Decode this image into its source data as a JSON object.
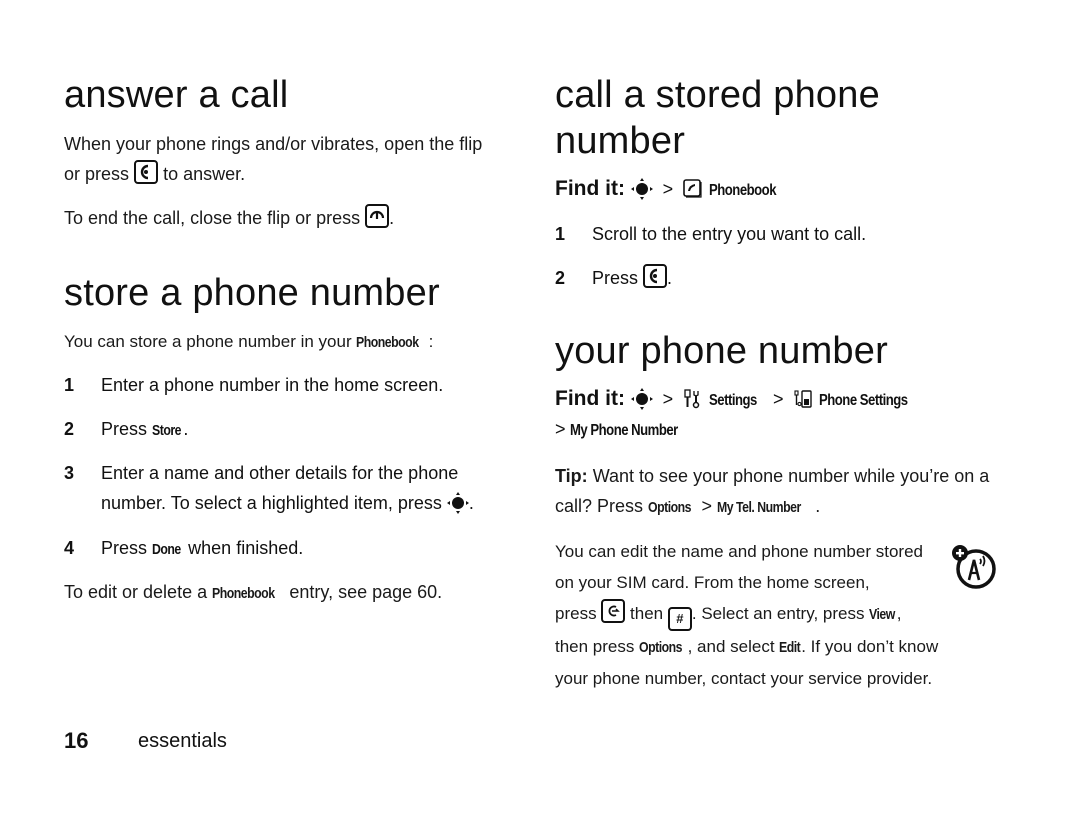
{
  "left": {
    "answer": {
      "title": "answer a call",
      "p1_a": "When your phone rings and/or vibrates, open the flip",
      "p1_b": "or press",
      "p1_c": "to answer.",
      "p2_a": "To end the call, close the flip or press",
      "p2_b": "."
    },
    "store": {
      "title": "store a phone number",
      "intro_a": "You can store a phone number in your",
      "intro_term": "Phonebook",
      "intro_b": ":",
      "steps": [
        {
          "num": "1",
          "text": "Enter a phone number in the home screen."
        },
        {
          "num": "2",
          "text_a": "Press",
          "term": "Store",
          "text_b": "."
        },
        {
          "num": "3",
          "text_a": "Enter a name and other details for the phone",
          "text_b": "number. To select a highlighted item, press",
          "text_c": "."
        },
        {
          "num": "4",
          "text_a": "Press",
          "term": "Done",
          "text_b": "when finished."
        }
      ],
      "outro_a": "To edit or delete a",
      "outro_term": "Phonebook",
      "outro_b": "entry, see page 60."
    }
  },
  "right": {
    "call_stored": {
      "title_line1": "call a stored phone",
      "title_line2": "number",
      "findit_label": "Find it:",
      "path": [
        ">",
        "Phonebook"
      ],
      "steps": [
        {
          "num": "1",
          "text": "Scroll to the entry you want to call."
        },
        {
          "num": "2",
          "text_a": "Press",
          "text_b": "."
        }
      ]
    },
    "your_number": {
      "title": "your phone number",
      "findit_label": "Find it:",
      "path": [
        ">",
        "Settings",
        ">",
        "Phone Settings",
        ">",
        "My Phone Number"
      ],
      "tip_label": "Tip:",
      "tip_a": "Want to see your phone number while you’re on a",
      "tip_b": "call? Press",
      "tip_term1": "Options",
      "tip_gt": ">",
      "tip_term2": "My Tel. Number",
      "tip_end": ".",
      "sim_l1": "You can edit the name and phone number stored",
      "sim_l2": "on your SIM card. From the home screen,",
      "sim_l3_a": "press",
      "sim_l3_b": "then",
      "sim_l3_c": ". Select an entry, press",
      "sim_l3_term": "View",
      "sim_l3_d": ",",
      "sim_l4_a": "then press",
      "sim_l4_term1": "Options",
      "sim_l4_b": ", and select",
      "sim_l4_term2": "Edit",
      "sim_l4_c": ". If you don’t know",
      "sim_l5": "your phone number, contact your service provider.",
      "hash_key": "#"
    }
  },
  "footer": {
    "page_number": "16",
    "section": "essentials"
  },
  "icons": {
    "send_key": "send-key-icon",
    "end_key": "end-key-icon",
    "nav_key": "nav-key-icon",
    "phonebook": "phonebook-icon",
    "settings": "settings-icon",
    "phone_settings": "phone-settings-icon",
    "clear_key": "clear-key-icon",
    "hash_key": "hash-key-icon",
    "sim_network": "network-feature-icon"
  }
}
